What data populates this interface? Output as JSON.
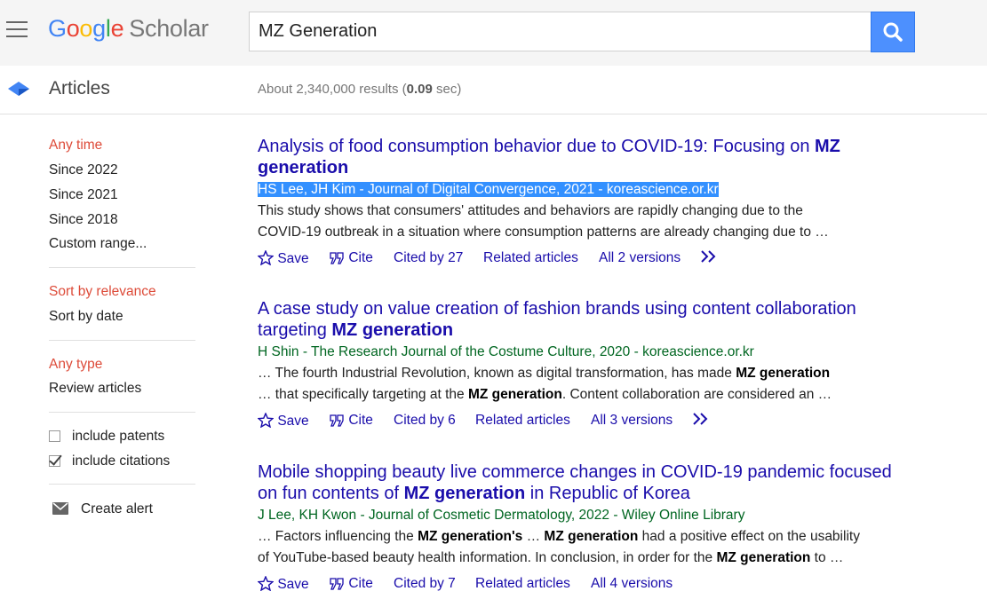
{
  "header": {
    "logo": {
      "g1": "G",
      "g2": "o",
      "g3": "o",
      "g4": "g",
      "g5": "l",
      "g6": "e",
      "scholar": "Scholar"
    },
    "search_value": "MZ Generation"
  },
  "subheader": {
    "section": "Articles",
    "results_prefix": "About 2,340,000 results (",
    "results_time": "0.09",
    "results_suffix": " sec)"
  },
  "sidebar": {
    "time_filters": [
      "Any time",
      "Since 2022",
      "Since 2021",
      "Since 2018",
      "Custom range..."
    ],
    "sort_options": [
      "Sort by relevance",
      "Sort by date"
    ],
    "type_options": [
      "Any type",
      "Review articles"
    ],
    "include_patents": "include patents",
    "include_citations": "include citations",
    "create_alert": "Create alert"
  },
  "results": [
    {
      "title_l1_pre": "Analysis of food consumption behavior due to COVID-19: Focusing on ",
      "title_l1_bold": "MZ",
      "title_l2_bold": "generation",
      "meta": "HS Lee, JH Kim - Journal of Digital Convergence, 2021 - koreascience.or.kr",
      "snippet_l1": "This study shows that consumers' attitudes and behaviors are rapidly changing due to the",
      "snippet_l2": "COVID-19 outbreak in a situation where consumption patterns are already changing due to …",
      "save": "Save",
      "cite": "Cite",
      "cited_by": "Cited by 27",
      "related": "Related articles",
      "versions": "All 2 versions"
    },
    {
      "title_l1": "A case study on value creation of fashion brands using content collaboration",
      "title_l2_pre": "targeting ",
      "title_l2_bold": "MZ generation",
      "meta": "H Shin - The Research Journal of the Costume Culture, 2020 - koreascience.or.kr",
      "snippet_l1_pre": "… The fourth Industrial Revolution, known as digital transformation, has made ",
      "snippet_l1_bold": "MZ generation",
      "snippet_l2_pre": "… that specifically targeting at the ",
      "snippet_l2_bold": "MZ generation",
      "snippet_l2_post": ". Content collaboration are considered an …",
      "save": "Save",
      "cite": "Cite",
      "cited_by": "Cited by 6",
      "related": "Related articles",
      "versions": "All 3 versions"
    },
    {
      "title_l1": "Mobile shopping beauty live commerce changes in COVID-19 pandemic focused",
      "title_l2_pre": "on fun contents of ",
      "title_l2_bold": "MZ generation",
      "title_l2_post": " in Republic of Korea",
      "meta": "J Lee, KH Kwon - Journal of Cosmetic Dermatology, 2022 - Wiley Online Library",
      "snippet_l1_pre": "… Factors influencing the ",
      "snippet_l1_bold1": "MZ generation's",
      "snippet_l1_mid": " … ",
      "snippet_l1_bold2": "MZ generation",
      "snippet_l1_post": " had a positive effect on the usability",
      "snippet_l2_pre": "of YouTube-based beauty health information. In conclusion, in order for the ",
      "snippet_l2_bold": "MZ generation",
      "snippet_l2_post": " to …",
      "save": "Save",
      "cite": "Cite",
      "cited_by": "Cited by 7",
      "related": "Related articles",
      "versions": "All 4 versions"
    }
  ]
}
